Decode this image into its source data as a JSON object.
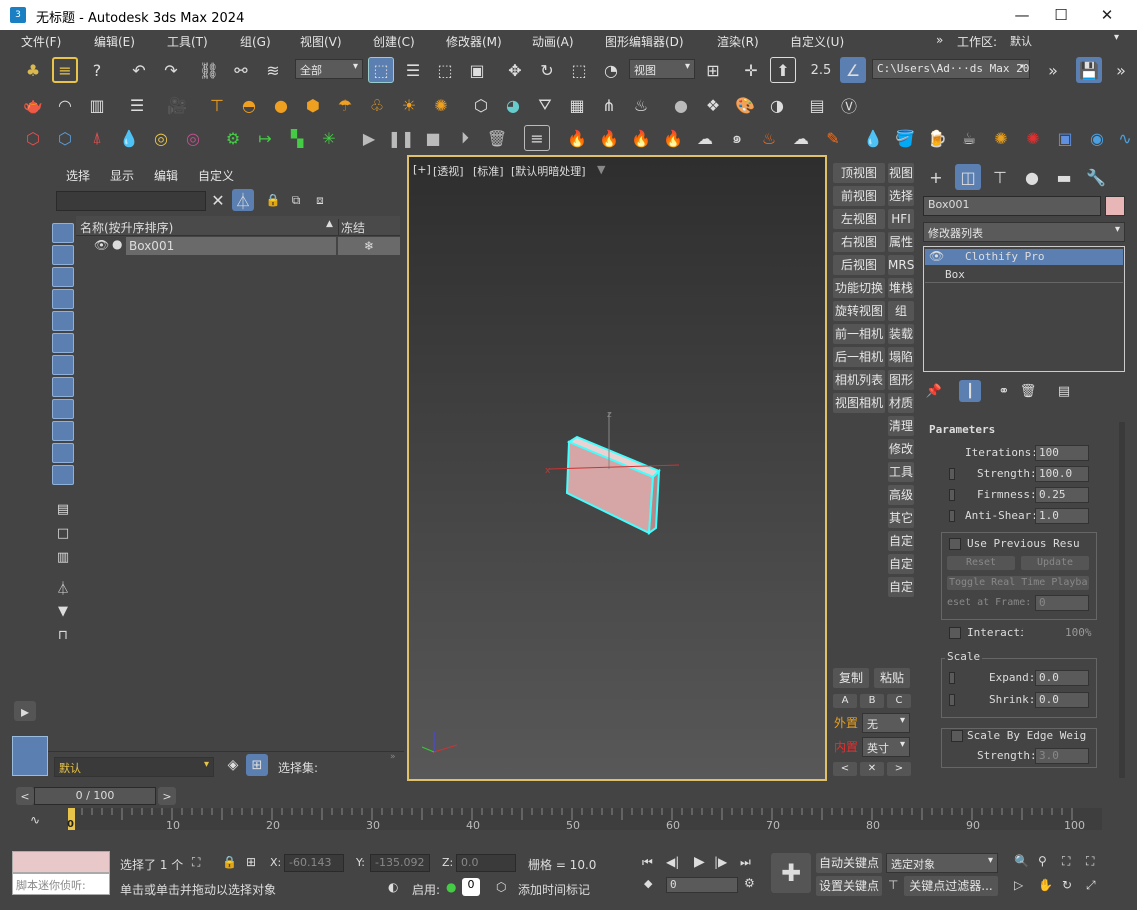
{
  "title": "无标题 - Autodesk 3ds Max 2024",
  "app_logo": "3",
  "menu": {
    "items": [
      "文件(F)",
      "编辑(E)",
      "工具(T)",
      "组(G)",
      "视图(V)",
      "创建(C)",
      "修改器(M)",
      "动画(A)",
      "图形编辑器(D)",
      "渲染(R)",
      "自定义(U)"
    ],
    "workspace_label": "工作区:",
    "workspace_value": "默认"
  },
  "toolbar": {
    "filter": "全部",
    "view": "视图",
    "snap": "2.5",
    "path": "C:\\Users\\Ad···ds Max 2024"
  },
  "explorer": {
    "tabs": [
      "选择",
      "显示",
      "编辑",
      "自定义"
    ],
    "col_name": "名称(按升序排序)",
    "col_freeze": "冻结",
    "row": "Box001",
    "layer": "默认",
    "selset": "选择集:"
  },
  "viewport": {
    "labels": [
      "[+]",
      "[透视]",
      "[标准]",
      "[默认明暗处理]"
    ]
  },
  "quick": {
    "left": [
      "顶视图",
      "前视图",
      "左视图",
      "右视图",
      "后视图",
      "功能切换",
      "旋转视图",
      "前一相机",
      "后一相机",
      "相机列表",
      "视图相机"
    ],
    "right": [
      "视图",
      "选择",
      "HFI",
      "属性",
      "MRS",
      "堆栈",
      "组",
      "装载",
      "塌陷",
      "图形",
      "材质",
      "清理",
      "修改",
      "工具",
      "高级",
      "其它",
      "自定",
      "自定",
      "自定"
    ],
    "copy": "复制",
    "paste": "粘贴",
    "abc": [
      "A",
      "B",
      "C"
    ],
    "outer_label": "外置",
    "outer_val": "无",
    "inner_label": "内置",
    "inner_val": "英寸"
  },
  "cmd": {
    "object_name": "Box001",
    "modlist": "修改器列表",
    "stack": [
      "Clothify Pro",
      "Box"
    ],
    "params_title": "Parameters",
    "iterations_label": "Iterations:",
    "iterations": "100",
    "strength_label": "Strength:",
    "strength": "100.0",
    "firmness_label": "Firmness:",
    "firmness": "0.25",
    "antishear_label": "Anti-Shear:",
    "antishear": "1.0",
    "use_prev": "Use Previous Resu",
    "reset": "Reset",
    "update": "Update",
    "toggle": "Toggle Real Time Playba",
    "reset_frame": "eset at Frame:",
    "reset_frame_val": "0",
    "interact": "Interacti",
    "interact_pct": "100%",
    "scale_title": "Scale",
    "expand_label": "Expand:",
    "expand": "0.0",
    "shrink_label": "Shrink:",
    "shrink": "0.0",
    "edge": "Scale By Edge Weig",
    "edge_strength_label": "Strength:",
    "edge_strength": "3.0"
  },
  "timeline": {
    "frame": "0 / 100",
    "ticks": [
      "0",
      "10",
      "20",
      "30",
      "40",
      "50",
      "60",
      "70",
      "80",
      "90",
      "100"
    ]
  },
  "status": {
    "script": "脚本迷你侦听:",
    "selected": "选择了 1 个",
    "x_label": "X:",
    "x": "-60.143",
    "y_label": "Y:",
    "y": "-135.092",
    "z_label": "Z:",
    "z": "0.0",
    "grid": "栅格 = 10.0",
    "prompt": "单击或单击并拖动以选择对象",
    "enable": "启用:",
    "add_time": "添加时间标记",
    "auto_key": "自动关键点",
    "set_key": "设置关键点",
    "sel_obj": "选定对象",
    "key_filter": "关键点过滤器...",
    "cur_frame": "0"
  },
  "colors": {
    "accent": "#5b7fb0",
    "selection": "#e0c16b",
    "box": "#e8b6b6"
  }
}
